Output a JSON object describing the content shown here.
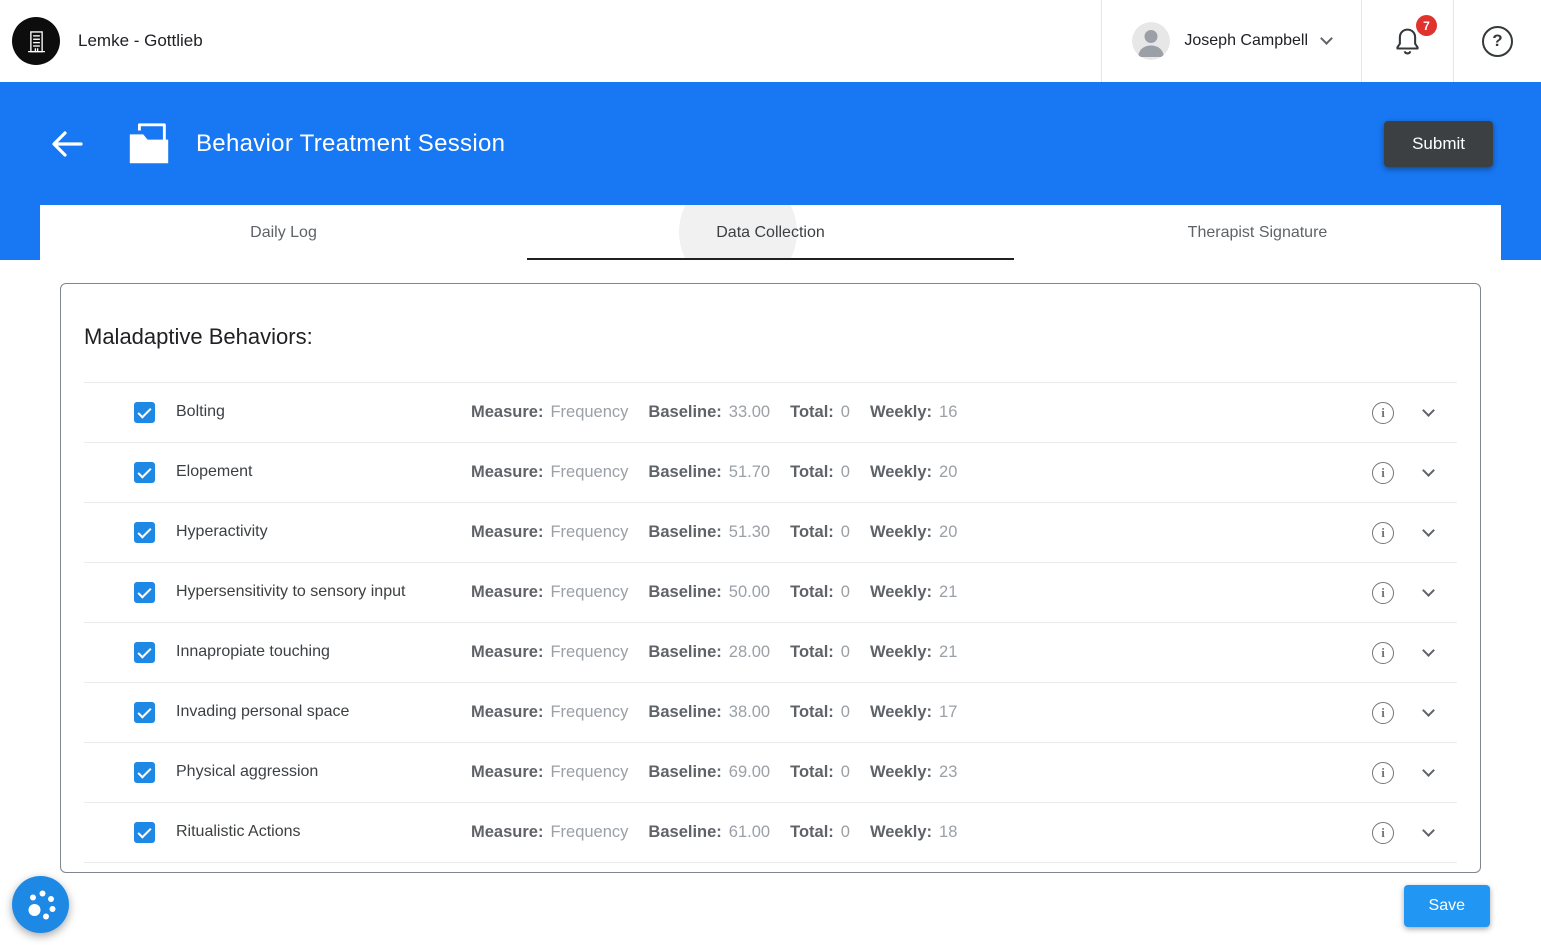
{
  "topbar": {
    "clinic_name": "Lemke - Gottlieb",
    "user_name": "Joseph Campbell",
    "notification_count": "7"
  },
  "header": {
    "title": "Behavior Treatment Session",
    "submit_label": "Submit"
  },
  "tabs": {
    "daily_log": "Daily Log",
    "data_collection": "Data Collection",
    "therapist_signature": "Therapist Signature"
  },
  "content": {
    "section_title": "Maladaptive Behaviors:",
    "field_labels": {
      "measure": "Measure:",
      "baseline": "Baseline:",
      "total": "Total:",
      "weekly": "Weekly:"
    },
    "behaviors": [
      {
        "name": "Bolting",
        "measure": "Frequency",
        "baseline": "33.00",
        "total": "0",
        "weekly": "16",
        "checked": true
      },
      {
        "name": "Elopement",
        "measure": "Frequency",
        "baseline": "51.70",
        "total": "0",
        "weekly": "20",
        "checked": true
      },
      {
        "name": "Hyperactivity",
        "measure": "Frequency",
        "baseline": "51.30",
        "total": "0",
        "weekly": "20",
        "checked": true
      },
      {
        "name": "Hypersensitivity to sensory input",
        "measure": "Frequency",
        "baseline": "50.00",
        "total": "0",
        "weekly": "21",
        "checked": true
      },
      {
        "name": "Innapropiate touching",
        "measure": "Frequency",
        "baseline": "28.00",
        "total": "0",
        "weekly": "21",
        "checked": true
      },
      {
        "name": "Invading personal space",
        "measure": "Frequency",
        "baseline": "38.00",
        "total": "0",
        "weekly": "17",
        "checked": true
      },
      {
        "name": "Physical aggression",
        "measure": "Frequency",
        "baseline": "69.00",
        "total": "0",
        "weekly": "23",
        "checked": true
      },
      {
        "name": "Ritualistic Actions",
        "measure": "Frequency",
        "baseline": "61.00",
        "total": "0",
        "weekly": "18",
        "checked": true
      }
    ],
    "save_label": "Save"
  },
  "icons": {
    "info_glyph": "i",
    "help_glyph": "?"
  },
  "colors": {
    "header_blue": "#1877F2",
    "accent_blue": "#2196F3",
    "checkbox_blue": "#1E88E5",
    "submit_dark": "#3C4043",
    "badge_red": "#E0332E",
    "active_tab_underline": "#202124"
  }
}
